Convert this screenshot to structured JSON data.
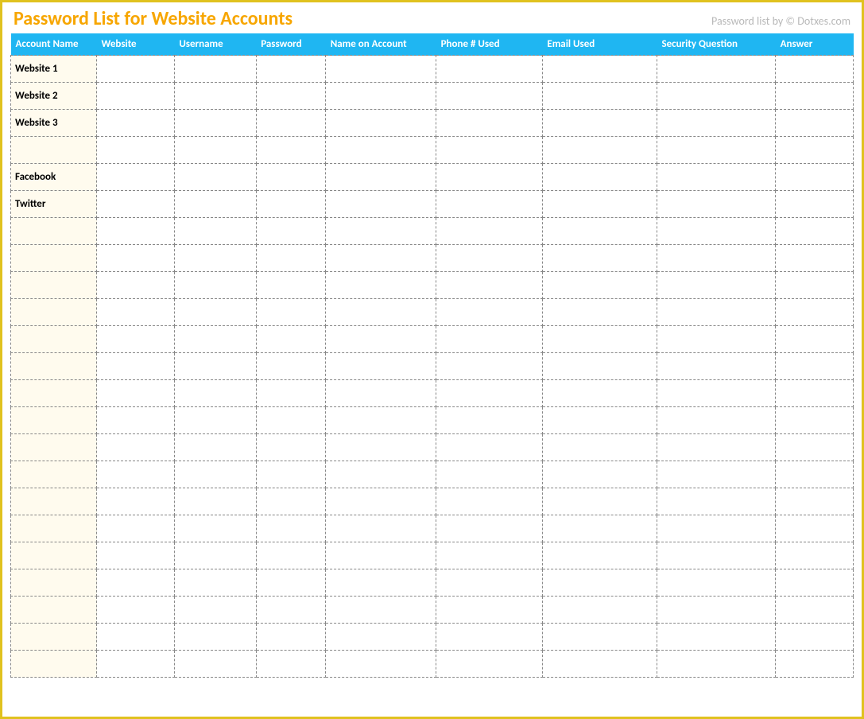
{
  "header": {
    "title": "Password List for Website Accounts",
    "credit": "Password list by © Dotxes.com"
  },
  "columns": [
    "Account Name",
    "Website",
    "Username",
    "Password",
    "Name on Account",
    "Phone # Used",
    "Email Used",
    "Security Question",
    "Answer"
  ],
  "rows": [
    {
      "account": "Website 1"
    },
    {
      "account": "Website 2"
    },
    {
      "account": "Website 3"
    },
    {
      "account": ""
    },
    {
      "account": "Facebook"
    },
    {
      "account": "Twitter"
    },
    {
      "account": ""
    },
    {
      "account": ""
    },
    {
      "account": ""
    },
    {
      "account": ""
    },
    {
      "account": ""
    },
    {
      "account": ""
    },
    {
      "account": ""
    },
    {
      "account": ""
    },
    {
      "account": ""
    },
    {
      "account": ""
    },
    {
      "account": ""
    },
    {
      "account": ""
    },
    {
      "account": ""
    },
    {
      "account": ""
    },
    {
      "account": ""
    },
    {
      "account": ""
    },
    {
      "account": ""
    }
  ]
}
